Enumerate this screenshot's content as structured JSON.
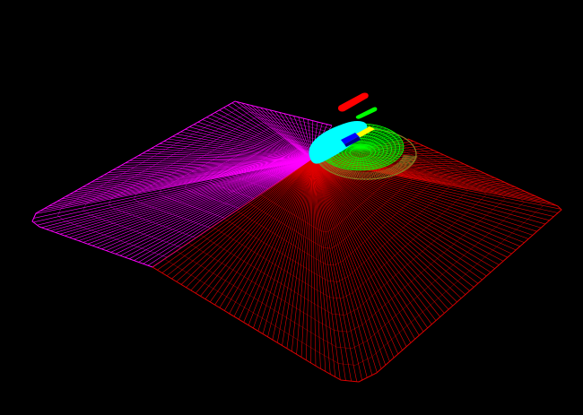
{
  "scene": {
    "background_color": "#000000",
    "meshes": [
      {
        "name": "left-wing-surface",
        "color": "#ff00ff",
        "style": "wireframe"
      },
      {
        "name": "right-floor-surface",
        "color": "#e00000",
        "style": "wireframe"
      },
      {
        "name": "cyan-dome",
        "color": "#00ffff",
        "style": "solid"
      },
      {
        "name": "green-mound",
        "color": "#00ff00",
        "style": "dense-wireframe"
      },
      {
        "name": "olive-skirt",
        "color": "#8a7a20",
        "style": "dense-wireframe"
      },
      {
        "name": "yellow-block",
        "color": "#ffff00",
        "style": "solid"
      },
      {
        "name": "blue-block",
        "color": "#0000ff",
        "style": "solid"
      },
      {
        "name": "red-floating-bar",
        "color": "#ff0000",
        "style": "solid"
      },
      {
        "name": "green-floating-bar",
        "color": "#00ff00",
        "style": "solid"
      }
    ]
  }
}
